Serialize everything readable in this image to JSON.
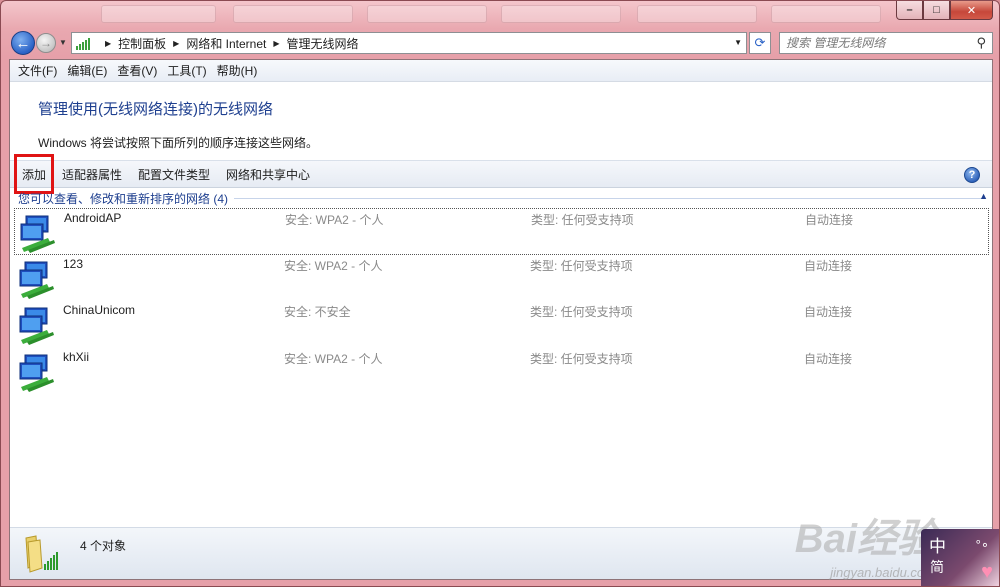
{
  "window": {
    "caption_buttons": {
      "minimize": "–",
      "maximize": "□",
      "close": "✕"
    }
  },
  "nav": {
    "back_icon": "←",
    "forward_icon": "→",
    "address": {
      "crumbs": [
        "控制面板",
        "网络和 Internet",
        "管理无线网络"
      ]
    },
    "refresh_icon": "⟳",
    "search_placeholder": "搜索 管理无线网络",
    "search_icon": "⚲"
  },
  "menubar": {
    "items": [
      "文件(F)",
      "编辑(E)",
      "查看(V)",
      "工具(T)",
      "帮助(H)"
    ]
  },
  "header": {
    "title": "管理使用(无线网络连接)的无线网络",
    "subtitle": "Windows 将尝试按照下面所列的顺序连接这些网络。"
  },
  "toolbar": {
    "items": [
      "添加",
      "适配器属性",
      "配置文件类型",
      "网络和共享中心"
    ],
    "help_icon": "?"
  },
  "group": {
    "label": "您可以查看、修改和重新排序的网络 (4)",
    "collapse_icon": "▲"
  },
  "networks": [
    {
      "name": "AndroidAP",
      "security": "安全: WPA2 - 个人",
      "type": "类型: 任何受支持项",
      "mode": "自动连接"
    },
    {
      "name": "123",
      "security": "安全: WPA2 - 个人",
      "type": "类型: 任何受支持项",
      "mode": "自动连接"
    },
    {
      "name": "ChinaUnicom",
      "security": "安全: 不安全",
      "type": "类型: 任何受支持项",
      "mode": "自动连接"
    },
    {
      "name": "khXii",
      "security": "安全: WPA2 - 个人",
      "type": "类型: 任何受支持项",
      "mode": "自动连接"
    }
  ],
  "status": {
    "text": "4 个对象"
  },
  "overlay": {
    "watermark": "Bai经验",
    "watermark_url": "jingyan.baidu.com",
    "ime_char1": "中",
    "ime_char2": "简"
  },
  "colors": {
    "accent_blue": "#1e3f8f",
    "highlight_red": "#e01414",
    "window_frame": "#e6a0a9"
  }
}
